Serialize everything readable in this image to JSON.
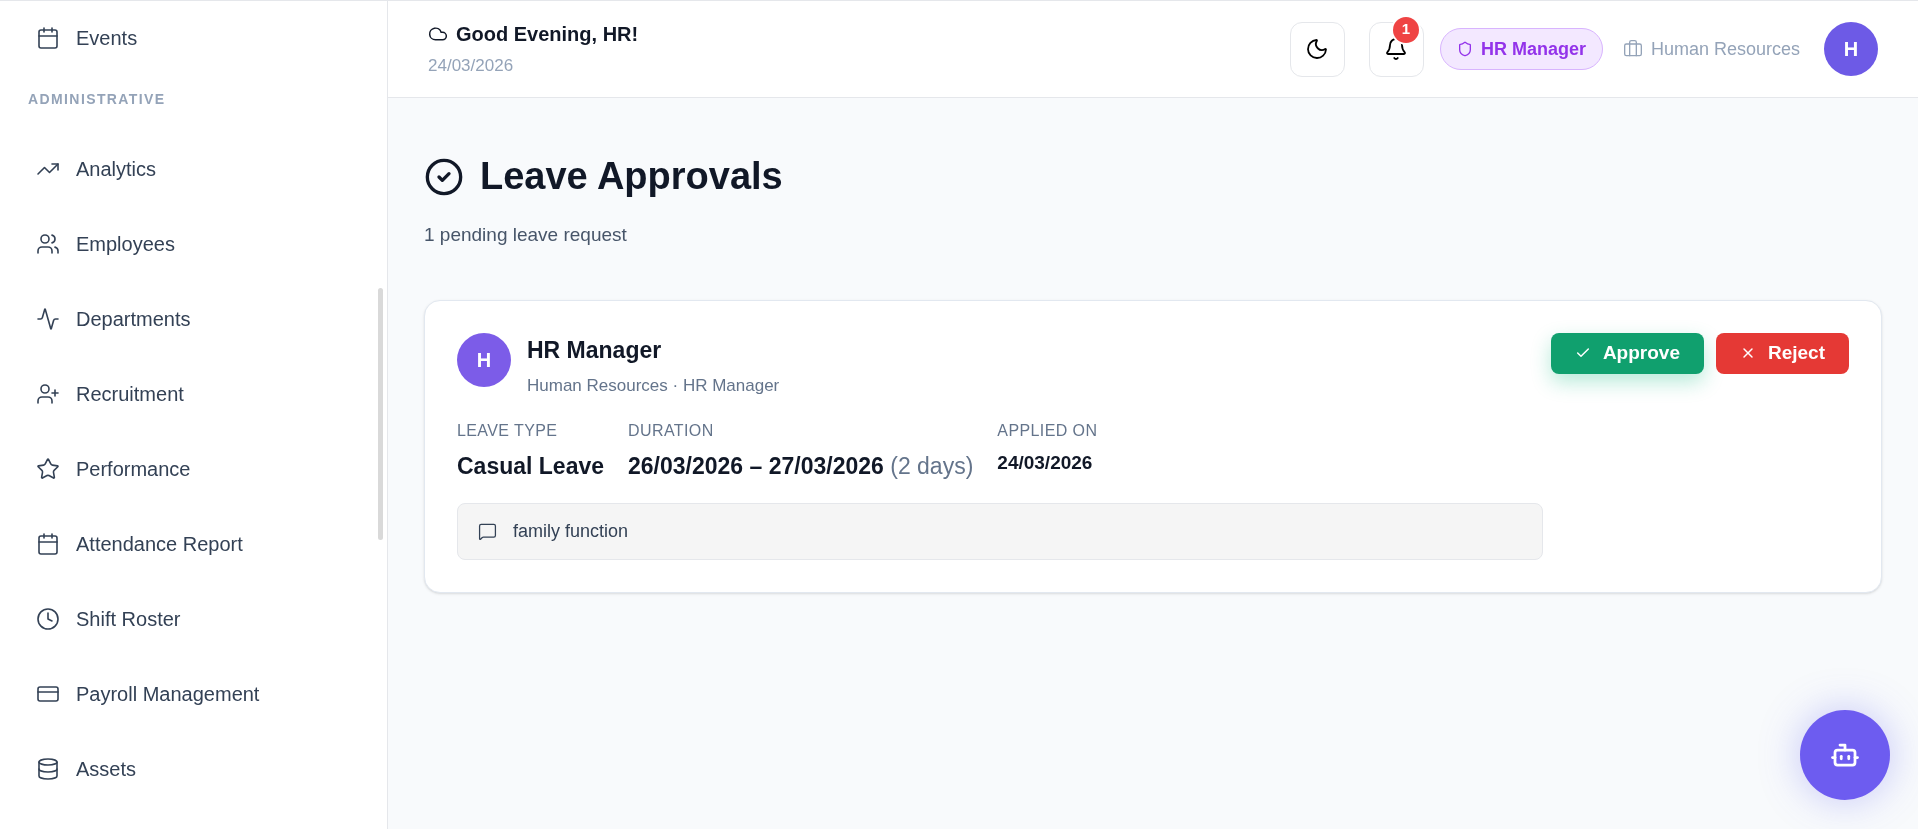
{
  "sidebar": {
    "top_items": [
      {
        "label": "Events",
        "selected": false
      }
    ],
    "section": "ADMINISTRATIVE",
    "items": [
      {
        "label": "Analytics",
        "selected": false
      },
      {
        "label": "Employees",
        "selected": false
      },
      {
        "label": "Departments",
        "selected": false
      },
      {
        "label": "Recruitment",
        "selected": false
      },
      {
        "label": "Performance",
        "selected": false
      },
      {
        "label": "Attendance Report",
        "selected": false
      },
      {
        "label": "Shift Roster",
        "selected": false
      },
      {
        "label": "Payroll Management",
        "selected": false
      },
      {
        "label": "Assets",
        "selected": false
      }
    ]
  },
  "header": {
    "greeting": "Good Evening, HR!",
    "date": "24/03/2026",
    "notification_count": "1",
    "role": "HR Manager",
    "department": "Human Resources",
    "avatar": "H"
  },
  "page": {
    "title": "Leave Approvals",
    "subtitle": "1 pending leave request"
  },
  "requests": [
    {
      "avatar": "H",
      "name": "HR Manager",
      "meta": "Human Resources · HR Manager",
      "fields": [
        {
          "label": "LEAVE TYPE",
          "value": "Casual Leave"
        },
        {
          "label": "DURATION",
          "value": "26/03/2026 – 27/03/2026",
          "note": "(2 days)"
        },
        {
          "label": "APPLIED ON",
          "value": "24/03/2026",
          "kind": "plain"
        }
      ],
      "reason": "family function",
      "actions": [
        "Approve",
        "Reject"
      ]
    }
  ]
}
